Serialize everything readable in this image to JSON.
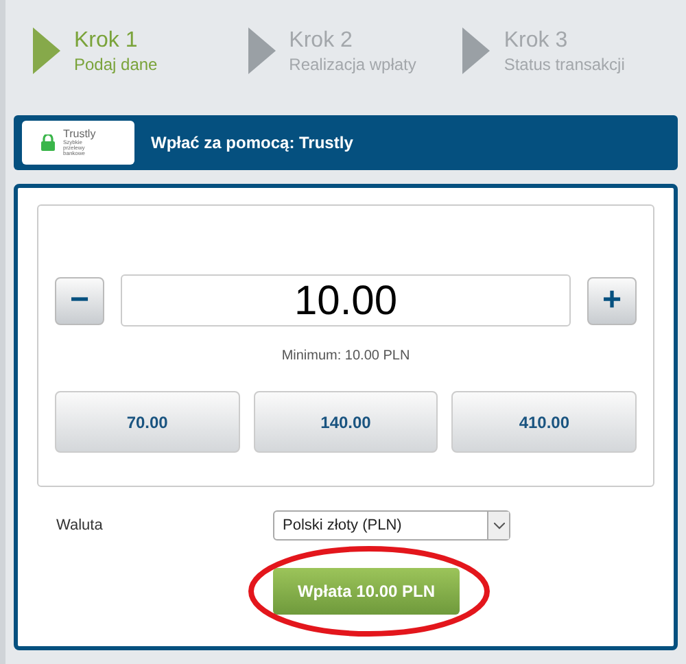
{
  "steps": [
    {
      "title": "Krok 1",
      "subtitle": "Podaj dane",
      "selected": true
    },
    {
      "title": "Krok 2",
      "subtitle": "Realizacja wpłaty",
      "selected": false
    },
    {
      "title": "Krok 3",
      "subtitle": "Status transakcji",
      "selected": false
    }
  ],
  "method_bar": {
    "logo_name": "Trustly",
    "logo_tagline": "Szybkie przelewy bankowe",
    "title": "Wpłać za pomocą: Trustly"
  },
  "amount": {
    "value": "10.00",
    "minus": "−",
    "plus": "+",
    "minimum": "Minimum: 10.00 PLN"
  },
  "quick_amounts": [
    "70.00",
    "140.00",
    "410.00"
  ],
  "currency": {
    "label": "Waluta",
    "value": "Polski złoty (PLN)"
  },
  "submit": {
    "label": "Wpłata 10.00 PLN",
    "highlighted": true
  }
}
